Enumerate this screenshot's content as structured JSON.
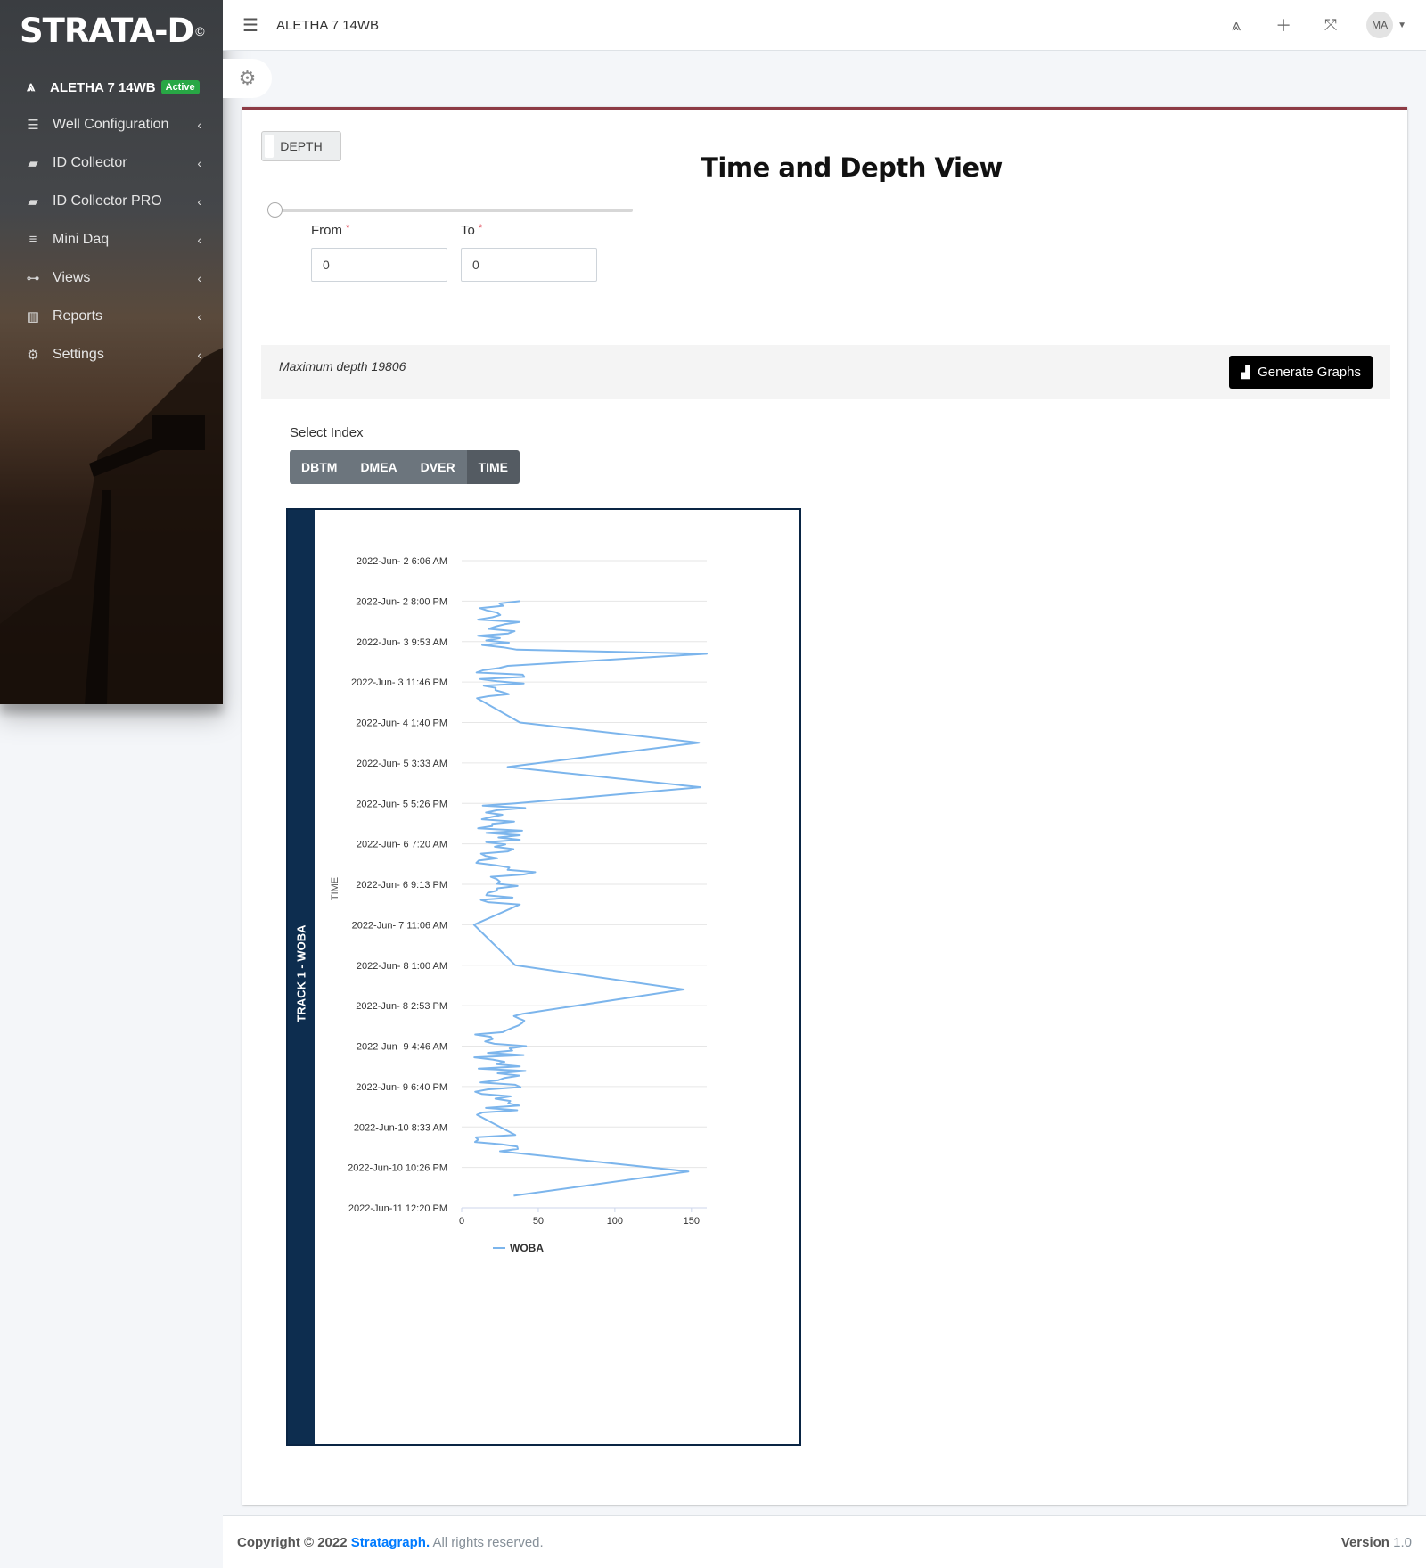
{
  "brand": {
    "name": "STRATA-D",
    "mark": "©"
  },
  "sidebar": {
    "well": {
      "name": "ALETHA 7 14WB",
      "status": "Active"
    },
    "items": [
      {
        "label": "Well Configuration",
        "icon": "sliders-icon"
      },
      {
        "label": "ID Collector",
        "icon": "piggy-icon"
      },
      {
        "label": "ID Collector PRO",
        "icon": "piggy-icon"
      },
      {
        "label": "Mini Daq",
        "icon": "database-icon"
      },
      {
        "label": "Views",
        "icon": "sitemap-icon"
      },
      {
        "label": "Reports",
        "icon": "chart-bar-icon"
      },
      {
        "label": "Settings",
        "icon": "cogs-icon"
      }
    ]
  },
  "topbar": {
    "title": "ALETHA 7 14WB",
    "avatar": "MA"
  },
  "main": {
    "toggle_label": "DEPTH",
    "title": "Time and Depth View",
    "from_label": "From",
    "to_label": "To",
    "required_mark": "*",
    "from_value": "0",
    "to_value": "0",
    "slider_value": 0,
    "max_depth_text": "Maximum depth 19806",
    "generate_label": "Generate Graphs",
    "select_index_label": "Select Index",
    "index_options": [
      "DBTM",
      "DMEA",
      "DVER",
      "TIME"
    ],
    "index_selected": "TIME"
  },
  "chart_data": {
    "type": "line",
    "track_title": "TRACK 1 - WOBA",
    "ylabel": "TIME",
    "xlabel": "",
    "x_ticks": [
      "0",
      "50",
      "100",
      "150"
    ],
    "xlim": [
      0,
      160
    ],
    "y_ticks": [
      "2022-Jun- 2 6:06 AM",
      "2022-Jun- 2 8:00 PM",
      "2022-Jun- 3 9:53 AM",
      "2022-Jun- 3 11:46 PM",
      "2022-Jun- 4 1:40 PM",
      "2022-Jun- 5 3:33 AM",
      "2022-Jun- 5 5:26 PM",
      "2022-Jun- 6 7:20 AM",
      "2022-Jun- 6 9:13 PM",
      "2022-Jun- 7 11:06 AM",
      "2022-Jun- 8 1:00 AM",
      "2022-Jun- 8 2:53 PM",
      "2022-Jun- 9 4:46 AM",
      "2022-Jun- 9 6:40 PM",
      "2022-Jun-10 8:33 AM",
      "2022-Jun-10 10:26 PM",
      "2022-Jun-11 12:20 PM"
    ],
    "legend": "WOBA",
    "series_color": "#7cb5ec",
    "series": [
      {
        "name": "WOBA",
        "y_tick_index": [
          1.0,
          1.4,
          2.2,
          2.3,
          2.6,
          3.2,
          3.4,
          4.0,
          4.5,
          5.1,
          5.6,
          6.0,
          6.9,
          7.7,
          8.5,
          9.0,
          10.0,
          10.6,
          11.2,
          12.0,
          12.5,
          13.3,
          13.7,
          14.2,
          14.6,
          15.1,
          15.7
        ],
        "values": [
          38,
          20,
          36,
          160,
          30,
          22,
          10,
          38,
          155,
          30,
          156,
          35,
          38,
          48,
          38,
          8,
          35,
          145,
          40,
          42,
          38,
          22,
          10,
          35,
          25,
          148,
          34
        ]
      }
    ]
  },
  "footer": {
    "copyright": "Copyright © 2022",
    "company": "Stratagraph.",
    "rights": "All rights reserved.",
    "version_label": "Version",
    "version": "1.0"
  }
}
